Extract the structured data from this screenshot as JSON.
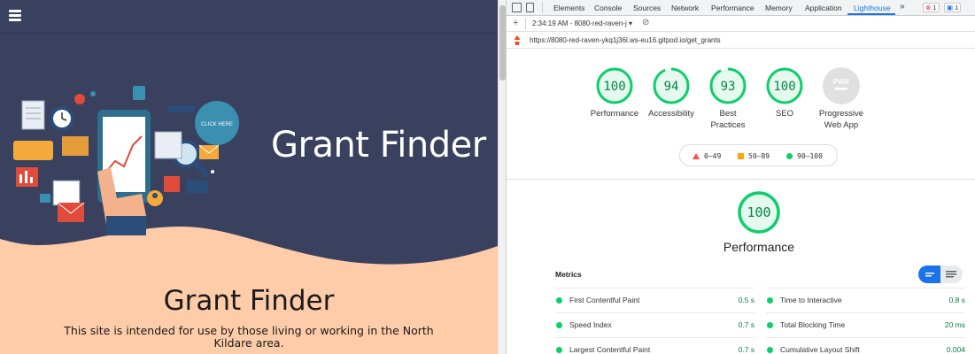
{
  "site": {
    "hero_title": "Grant Finder",
    "content_title": "Grant Finder",
    "description": "This site is intended for use by those living or working in the North Kildare area.",
    "illustration_button": "CLICK HERE",
    "colors": {
      "nav": "#39415f",
      "hero": "#39415f",
      "body": "#fecca8"
    }
  },
  "devtools": {
    "tabs": [
      "Elements",
      "Console",
      "Sources",
      "Network",
      "Performance",
      "Memory",
      "Application",
      "Lighthouse"
    ],
    "active_tab": "Lighthouse",
    "more_tabs": "»",
    "errors_count": "1",
    "messages_count": "1",
    "toolbar": {
      "add": "+",
      "report_select": "2:34:19 AM - 8080-red-raven-j"
    },
    "url": "https://8080-red-raven-ykq1j36l.ws-eu16.gitpod.io/get_grants"
  },
  "lighthouse": {
    "scores": [
      {
        "label": "Performance",
        "value": "100",
        "pct": 1.0
      },
      {
        "label": "Accessibility",
        "value": "94",
        "pct": 0.94
      },
      {
        "label": "Best Practices",
        "value": "93",
        "pct": 0.93
      },
      {
        "label": "SEO",
        "value": "100",
        "pct": 1.0
      },
      {
        "label": "Progressive Web App",
        "value": "PWA",
        "pct": 0
      }
    ],
    "legend": [
      {
        "range": "0–49",
        "color": "#ff4e42",
        "shape": "triangle"
      },
      {
        "range": "50–89",
        "color": "#ffa400",
        "shape": "square"
      },
      {
        "range": "90–100",
        "color": "#0cce6b",
        "shape": "circle"
      }
    ],
    "performance": {
      "score": "100",
      "label": "Performance"
    },
    "metrics_title": "Metrics",
    "metrics": [
      {
        "name": "First Contentful Paint",
        "value": "0.5 s"
      },
      {
        "name": "Time to Interactive",
        "value": "0.8 s"
      },
      {
        "name": "Speed Index",
        "value": "0.7 s"
      },
      {
        "name": "Total Blocking Time",
        "value": "20 ms"
      },
      {
        "name": "Largest Contentful Paint",
        "value": "0.7 s"
      },
      {
        "name": "Cumulative Layout Shift",
        "value": "0.004"
      }
    ],
    "colors": {
      "pass": "#0cce6b",
      "pass_text": "#018642",
      "pass_bg": "#e6f9ef"
    }
  }
}
